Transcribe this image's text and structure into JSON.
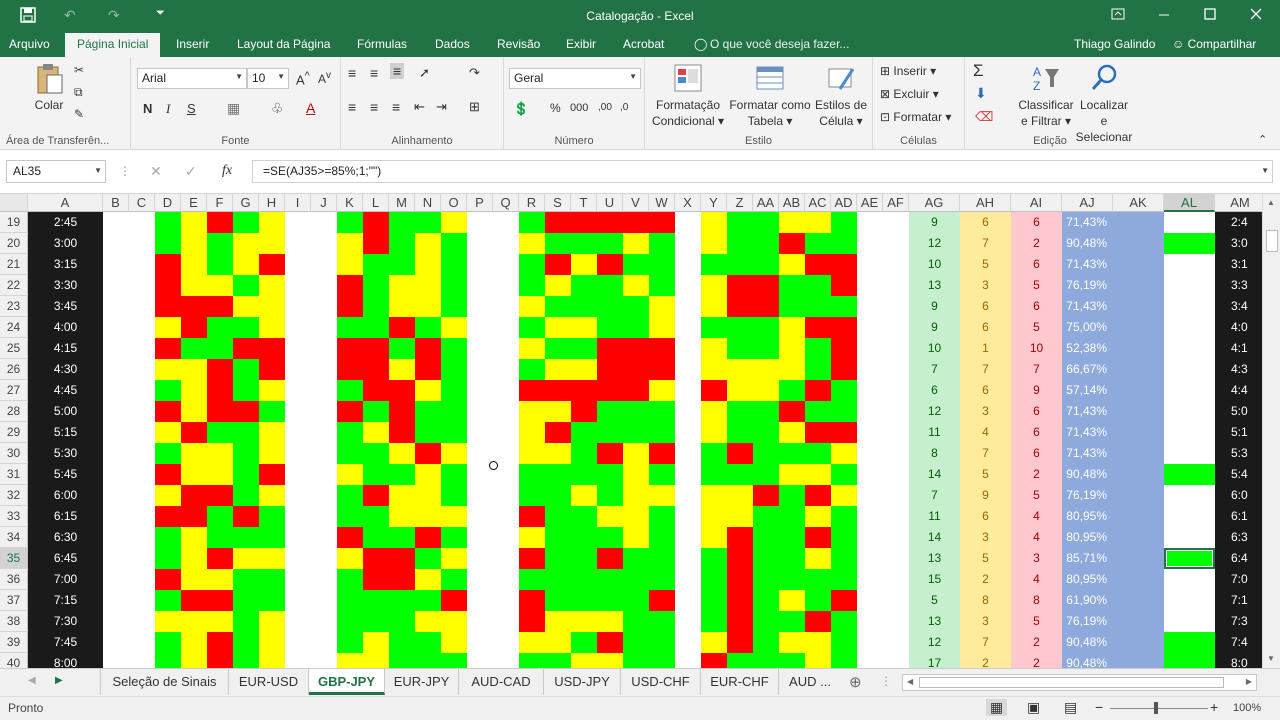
{
  "app": {
    "title": "Catalogação - Excel",
    "user": "Thiago Galindo",
    "share": "Compartilhar",
    "tell_me": "O que você deseja fazer..."
  },
  "tabs": [
    "Arquivo",
    "Página Inicial",
    "Inserir",
    "Layout da Página",
    "Fórmulas",
    "Dados",
    "Revisão",
    "Exibir",
    "Acrobat"
  ],
  "ribbon": {
    "clipboard": {
      "paste": "Colar",
      "label": "Área de Transferên..."
    },
    "font": {
      "name": "Arial",
      "size": "10",
      "bold": "N",
      "italic": "I",
      "underline": "S",
      "label": "Fonte"
    },
    "alignment": {
      "label": "Alinhamento"
    },
    "number": {
      "format": "Geral",
      "label": "Número"
    },
    "styles": {
      "cond_format_1": "Formatação",
      "cond_format_2": "Condicional",
      "format_table_1": "Formatar como",
      "format_table_2": "Tabela",
      "cell_styles_1": "Estilos de",
      "cell_styles_2": "Célula",
      "label": "Estilo"
    },
    "cells": {
      "insert": "Inserir",
      "delete": "Excluir",
      "format": "Formatar",
      "label": "Células"
    },
    "editing": {
      "sort_1": "Classificar",
      "sort_2": "e Filtrar",
      "find_1": "Localizar e",
      "find_2": "Selecionar",
      "label": "Edição"
    }
  },
  "formula_bar": {
    "name_box": "AL35",
    "fx": "fx",
    "formula": "=SE(AJ35>=85%;1;\"\")"
  },
  "columns": [
    "A",
    "B",
    "C",
    "D",
    "E",
    "F",
    "G",
    "H",
    "I",
    "J",
    "K",
    "L",
    "M",
    "N",
    "O",
    "P",
    "Q",
    "R",
    "S",
    "T",
    "U",
    "V",
    "W",
    "X",
    "Y",
    "Z",
    "AA",
    "AB",
    "AC",
    "AD",
    "AE",
    "AF",
    "AG",
    "AH",
    "AI",
    "AJ",
    "AK",
    "AL",
    "AM"
  ],
  "rows": [
    {
      "n": "19",
      "time": "2:45",
      "ag": "9",
      "ah": "6",
      "ai": "6",
      "aj": "71,43%",
      "al": false,
      "am": "2:4"
    },
    {
      "n": "20",
      "time": "3:00",
      "ag": "12",
      "ah": "7",
      "ai": "2",
      "aj": "90,48%",
      "al": true,
      "am": "3:0"
    },
    {
      "n": "21",
      "time": "3:15",
      "ag": "10",
      "ah": "5",
      "ai": "6",
      "aj": "71,43%",
      "al": false,
      "am": "3:1"
    },
    {
      "n": "22",
      "time": "3:30",
      "ag": "13",
      "ah": "3",
      "ai": "5",
      "aj": "76,19%",
      "al": false,
      "am": "3:3"
    },
    {
      "n": "23",
      "time": "3:45",
      "ag": "9",
      "ah": "6",
      "ai": "6",
      "aj": "71,43%",
      "al": false,
      "am": "3:4"
    },
    {
      "n": "24",
      "time": "4:00",
      "ag": "9",
      "ah": "6",
      "ai": "5",
      "aj": "75,00%",
      "al": false,
      "am": "4:0"
    },
    {
      "n": "25",
      "time": "4:15",
      "ag": "10",
      "ah": "1",
      "ai": "10",
      "aj": "52,38%",
      "al": false,
      "am": "4:1"
    },
    {
      "n": "26",
      "time": "4:30",
      "ag": "7",
      "ah": "7",
      "ai": "7",
      "aj": "66,67%",
      "al": false,
      "am": "4:3"
    },
    {
      "n": "27",
      "time": "4:45",
      "ag": "6",
      "ah": "6",
      "ai": "9",
      "aj": "57,14%",
      "al": false,
      "am": "4:4"
    },
    {
      "n": "28",
      "time": "5:00",
      "ag": "12",
      "ah": "3",
      "ai": "6",
      "aj": "71,43%",
      "al": false,
      "am": "5:0"
    },
    {
      "n": "29",
      "time": "5:15",
      "ag": "11",
      "ah": "4",
      "ai": "6",
      "aj": "71,43%",
      "al": false,
      "am": "5:1"
    },
    {
      "n": "30",
      "time": "5:30",
      "ag": "8",
      "ah": "7",
      "ai": "6",
      "aj": "71,43%",
      "al": false,
      "am": "5:3"
    },
    {
      "n": "31",
      "time": "5:45",
      "ag": "14",
      "ah": "5",
      "ai": "2",
      "aj": "90,48%",
      "al": true,
      "am": "5:4"
    },
    {
      "n": "32",
      "time": "6:00",
      "ag": "7",
      "ah": "9",
      "ai": "5",
      "aj": "76,19%",
      "al": false,
      "am": "6:0"
    },
    {
      "n": "33",
      "time": "6:15",
      "ag": "11",
      "ah": "6",
      "ai": "4",
      "aj": "80,95%",
      "al": false,
      "am": "6:1"
    },
    {
      "n": "34",
      "time": "6:30",
      "ag": "14",
      "ah": "3",
      "ai": "4",
      "aj": "80,95%",
      "al": false,
      "am": "6:3"
    },
    {
      "n": "35",
      "time": "6:45",
      "ag": "13",
      "ah": "5",
      "ai": "3",
      "aj": "85,71%",
      "al": true,
      "am": "6:4"
    },
    {
      "n": "36",
      "time": "7:00",
      "ag": "15",
      "ah": "2",
      "ai": "4",
      "aj": "80,95%",
      "al": false,
      "am": "7:0"
    },
    {
      "n": "37",
      "time": "7:15",
      "ag": "5",
      "ah": "8",
      "ai": "8",
      "aj": "61,90%",
      "al": false,
      "am": "7:1"
    },
    {
      "n": "38",
      "time": "7:30",
      "ag": "13",
      "ah": "3",
      "ai": "5",
      "aj": "76,19%",
      "al": false,
      "am": "7:3"
    },
    {
      "n": "39",
      "time": "7:45",
      "ag": "12",
      "ah": "7",
      "ai": "2",
      "aj": "90,48%",
      "al": true,
      "am": "7:4"
    },
    {
      "n": "40",
      "time": "8:00",
      "ag": "17",
      "ah": "2",
      "ai": "2",
      "aj": "90,48%",
      "al": true,
      "am": "8:0"
    }
  ],
  "blocks": [
    [
      "gyrgy",
      "gygyy",
      "rygyr",
      "ryygy",
      "rrryy",
      "yrggy",
      "rggrr",
      "yyrgr",
      "gyrgy",
      "ryrrg",
      "yrggy",
      "gyygy",
      "ryygr",
      "yrrgy",
      "rrgrg",
      "gyggg",
      "gyryy",
      "ryygg",
      "grrgg",
      "yyygy",
      "gyrgy",
      "gyrgy"
    ],
    [
      "grggy",
      "yrgyg",
      "yggyg",
      "rgyyg",
      "rgyyg",
      "ggrgy",
      "rrgrg",
      "rryrg",
      "grryg",
      "rgrgg",
      "gyrgg",
      "ggyry",
      "yggyg",
      "gryyg",
      "ggyyy",
      "rggrg",
      "yrrgy",
      "grryg",
      "ggggr",
      "gggyy",
      "gyggy",
      "yyggg"
    ],
    [
      "grrrrr",
      "ygggyg",
      "gryrgg",
      "gyggyg",
      "yggggy",
      "gyyggy",
      "yggrrr",
      "gyyrrr",
      "rrrrry",
      "yyrggg",
      "yrgggg",
      "yygryr",
      "ggggyg",
      "ggygyy",
      "rggyyg",
      "ygggyg",
      "rggrgg",
      "gggggg",
      "rggggr",
      "ryyygg",
      "yygrgg",
      "ggyygg"
    ],
    [
      "yggyyg",
      "yggrgg",
      "gggyrr",
      "yrrggr",
      "yrrggg",
      "gggyrr",
      "yggygr",
      "yyyygr",
      "ryygrg",
      "yggrgg",
      "yggyrr",
      "grgggy",
      "gggyyg",
      "yyrgry",
      "yyggyg",
      "yrggrg",
      "grggyg",
      "grgggg",
      "grgygr",
      "grggrg",
      "yrgyyg",
      "rgggyg"
    ]
  ],
  "sheets": [
    "Seleção de Sinais",
    "EUR-USD",
    "GBP-JPY",
    "EUR-JPY",
    "AUD-CAD",
    "USD-JPY",
    "USD-CHF",
    "EUR-CHF",
    "AUD ..."
  ],
  "active_sheet": "GBP-JPY",
  "status": {
    "ready": "Pronto",
    "zoom": "100%"
  },
  "colors": {
    "red": "#ff0000",
    "yellow": "#ffff00",
    "green": "#00ff00",
    "excel_green": "#217346",
    "ag_bg": "#c6efce",
    "ah_bg": "#ffeb9c",
    "ai_bg": "#ffc7ce",
    "aj_bg": "#8ea9db",
    "time_bg": "#1a1a1a"
  }
}
